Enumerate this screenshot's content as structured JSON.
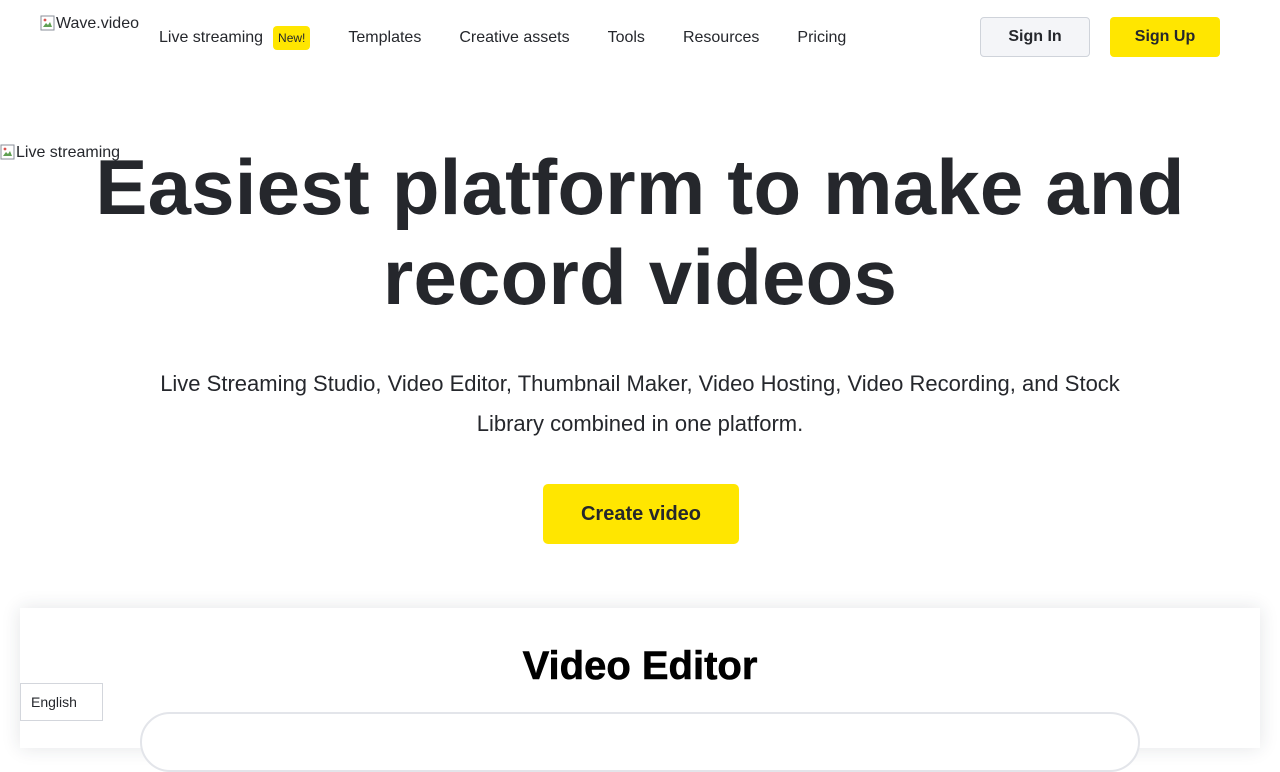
{
  "header": {
    "logo_alt": "Wave.video",
    "nav": [
      {
        "label": "Live streaming",
        "badge": "New!"
      },
      {
        "label": "Templates"
      },
      {
        "label": "Creative assets"
      },
      {
        "label": "Tools"
      },
      {
        "label": "Resources"
      },
      {
        "label": "Pricing"
      }
    ],
    "signin_label": "Sign In",
    "signup_label": "Sign Up"
  },
  "hero": {
    "image_alt": "Live streaming",
    "title": "Easiest platform to make and record videos",
    "subtitle": "Live Streaming Studio, Video Editor, Thumbnail Maker, Video Hosting, Video Recording, and Stock Library combined in one platform.",
    "cta_label": "Create video"
  },
  "editor_section": {
    "title": "Video Editor"
  },
  "language_selector": {
    "value": "English"
  },
  "colors": {
    "accent_yellow": "#ffe600",
    "text_dark": "#25272c"
  }
}
